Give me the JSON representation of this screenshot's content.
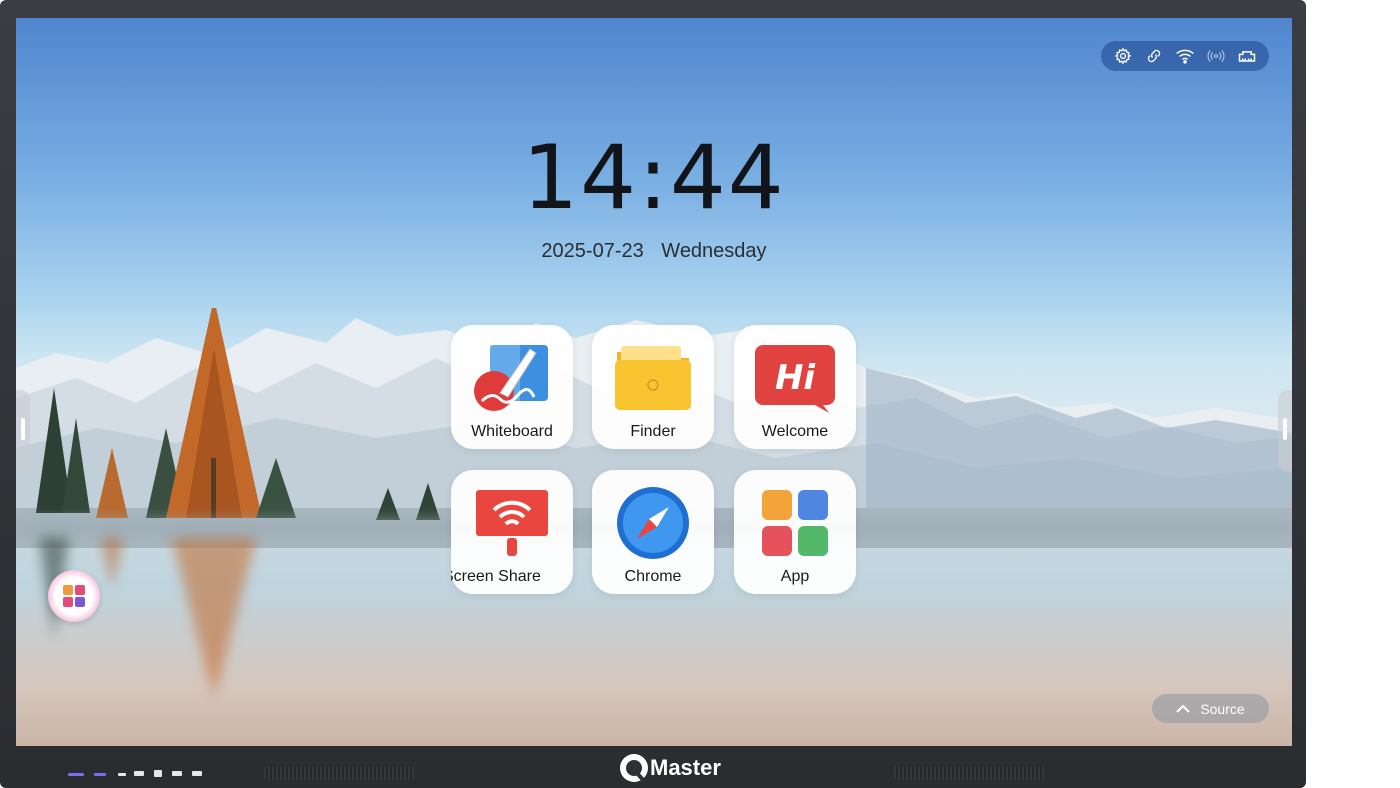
{
  "status_bar": {
    "icons": [
      "settings-icon",
      "link-icon",
      "wifi-icon",
      "hotspot-icon",
      "ethernet-icon"
    ]
  },
  "clock": {
    "time": "14:44"
  },
  "date": {
    "date": "2025-07-23",
    "weekday": "Wednesday"
  },
  "apps": [
    {
      "label": "Whiteboard",
      "icon": "whiteboard-icon"
    },
    {
      "label": "Finder",
      "icon": "folder-icon"
    },
    {
      "label": "Welcome",
      "icon": "hi-icon"
    },
    {
      "label": "Screen Share",
      "icon": "screen-share-icon"
    },
    {
      "label": "Chrome",
      "icon": "compass-icon"
    },
    {
      "label": "App",
      "icon": "app-grid-icon"
    }
  ],
  "source_button": {
    "label": "Source"
  },
  "brand": {
    "name": "Master"
  },
  "colors": {
    "status_bar_bg": "#2f5fa8",
    "tile_bg": "#ffffff",
    "clock_text": "#111418"
  }
}
